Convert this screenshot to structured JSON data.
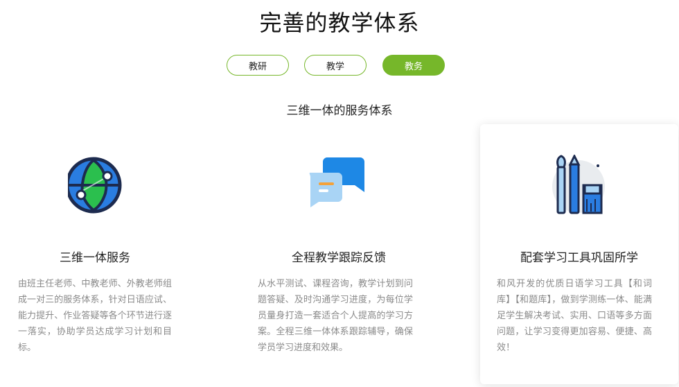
{
  "page": {
    "title": "完善的教学体系",
    "subtitle": "三维一体的服务体系"
  },
  "tabs": [
    {
      "label": "教研",
      "active": false
    },
    {
      "label": "教学",
      "active": false
    },
    {
      "label": "教务",
      "active": true
    }
  ],
  "colors": {
    "accent": "#76b72a",
    "title_text": "#222222",
    "desc_text": "#8a8a8a",
    "icon_blue": "#2a7de1",
    "icon_green": "#2bbf4e",
    "icon_navy": "#1d2b4f",
    "icon_light_blue": "#a9d4f5"
  },
  "cards": [
    {
      "icon": "globe-icon",
      "title": "三维一体服务",
      "desc": "由班主任老师、中教老师、外教老师组成一对三的服务体系，针对日语应试、能力提升、作业答疑等各个环节进行逐一落实，协助学员达成学习计划和目标。",
      "highlighted": false
    },
    {
      "icon": "chat-bubbles-icon",
      "title": "全程教学跟踪反馈",
      "desc": "从水平测试、课程咨询，教学计划到问题答疑、及时沟通学习进度，为每位学员量身打造一套适合个人提高的学习方案。全程三维一体体系跟踪辅导，确保学员学习进度和效果。",
      "highlighted": false
    },
    {
      "icon": "tools-icon",
      "title": "配套学习工具巩固所学",
      "desc": "和风开发的优质日语学习工具【和词库】【和题库】，做到学测练一体、能满足学生解决考试、实用、口语等多方面问题，让学习变得更加容易、便捷、高效！",
      "highlighted": true
    }
  ]
}
